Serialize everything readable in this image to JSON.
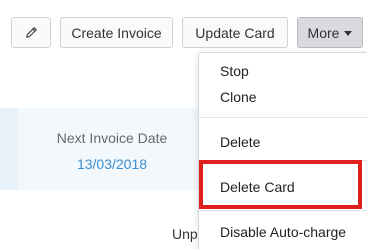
{
  "toolbar": {
    "edit_icon": "pencil-icon",
    "create_invoice_label": "Create Invoice",
    "update_card_label": "Update Card",
    "more_label": "More",
    "more_icon": "caret-down-icon"
  },
  "summary": {
    "next_invoice_label": "Next Invoice Date",
    "next_invoice_date": "13/03/2018",
    "partial_label": "Unp"
  },
  "more_menu": {
    "items": [
      {
        "label": "Stop"
      },
      {
        "label": "Clone"
      },
      {
        "label": "Delete"
      },
      {
        "label": "Delete Card"
      },
      {
        "label": "Disable Auto-charge"
      }
    ]
  },
  "colors": {
    "highlight_border": "#e01f1f",
    "date_link": "#3b8fd0",
    "info_background": "#f2f8fc"
  }
}
